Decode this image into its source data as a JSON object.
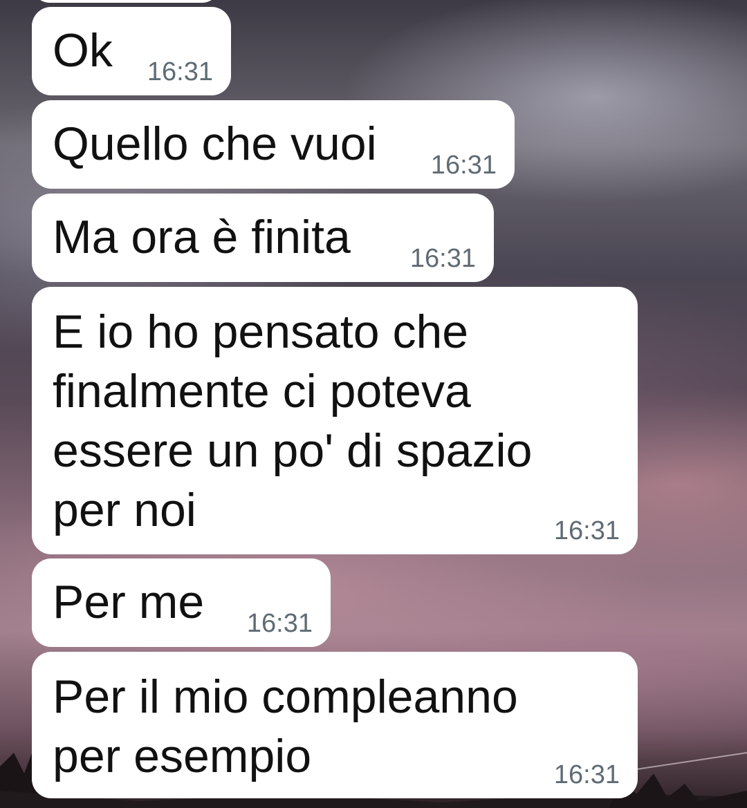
{
  "messages": [
    {
      "text": "Ok",
      "time": "16:31"
    },
    {
      "text": "Quello che vuoi",
      "time": "16:31"
    },
    {
      "text": "Ma ora è finita",
      "time": "16:31"
    },
    {
      "text": "E io ho pensato che\nfinalmente ci poteva\nessere un po' di spazio\nper noi",
      "time": "16:31"
    },
    {
      "text": "Per me",
      "time": "16:31"
    },
    {
      "text": "Per il mio compleanno\nper esempio",
      "time": "16:31"
    }
  ]
}
